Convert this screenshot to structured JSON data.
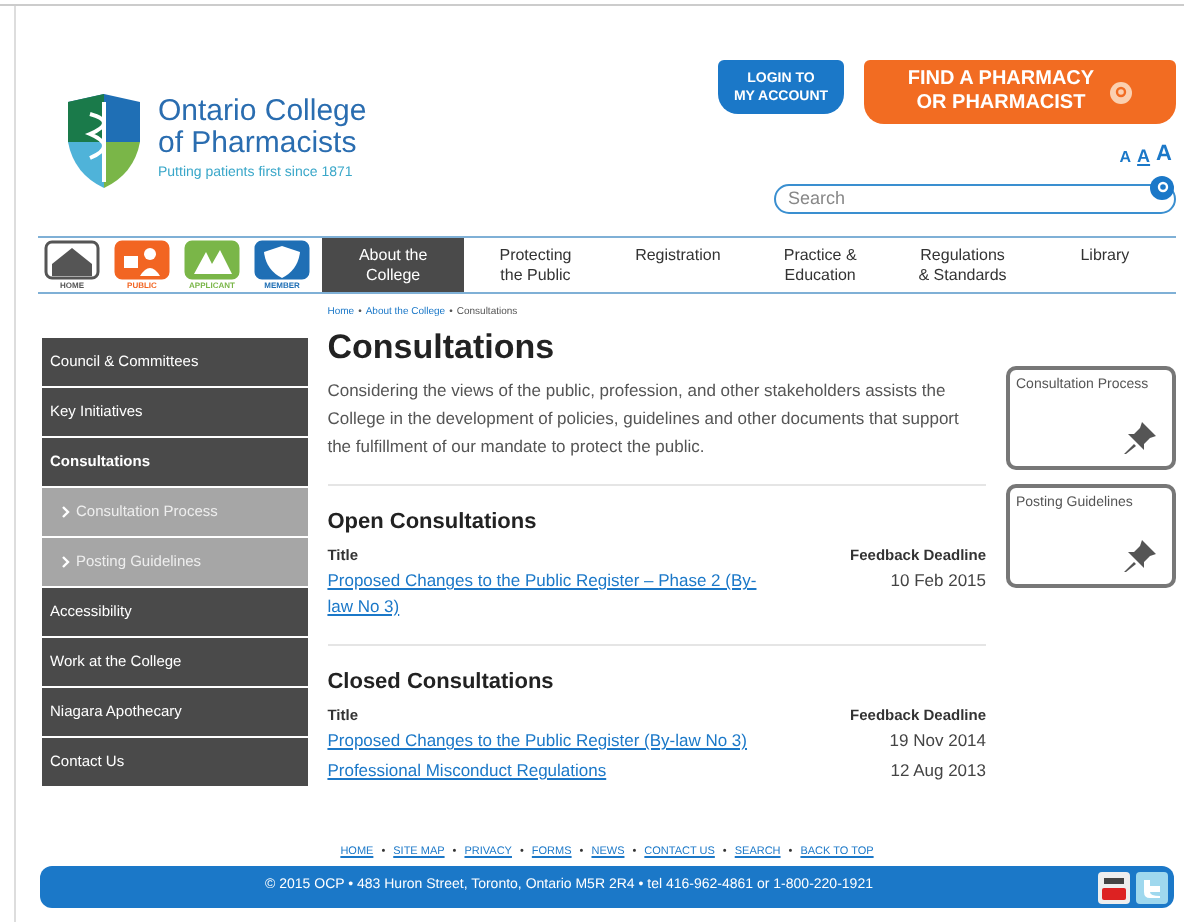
{
  "logo": {
    "name_line1": "Ontario College",
    "name_line2": "of Pharmacists",
    "tagline": "Putting patients first since 1871"
  },
  "login_button": {
    "line1": "LOGIN TO",
    "line2": "MY ACCOUNT"
  },
  "find_button": {
    "line1": "FIND A PHARMACY",
    "line2": "OR PHARMACIST"
  },
  "text_size": [
    {
      "label": "A",
      "selected": false
    },
    {
      "label": "A",
      "selected": true
    },
    {
      "label": "A",
      "selected": false
    }
  ],
  "search": {
    "placeholder": "Search"
  },
  "nav_icons": [
    {
      "label": "HOME",
      "kind": "home",
      "color": "#555555"
    },
    {
      "label": "PUBLIC",
      "kind": "public",
      "color": "#f26522"
    },
    {
      "label": "APPLICANT",
      "kind": "applicant",
      "color": "#7ab648"
    },
    {
      "label": "MEMBER",
      "kind": "member",
      "color": "#1f6fb5"
    }
  ],
  "nav_tabs": [
    {
      "line1": "About the",
      "line2": "College",
      "selected": true
    },
    {
      "line1": "Protecting",
      "line2": "the Public",
      "selected": false
    },
    {
      "line1": "Registration",
      "selected": false
    },
    {
      "line1": "Practice &",
      "line2": "Education",
      "selected": false
    },
    {
      "line1": "Regulations",
      "line2": "& Standards",
      "selected": false
    },
    {
      "line1": "Library",
      "selected": false
    }
  ],
  "breadcrumb": [
    "Home",
    "About the College",
    "Consultations"
  ],
  "sidebar": {
    "items": [
      {
        "label": "Council & Committees",
        "selected": false
      },
      {
        "label": "Key Initiatives",
        "selected": false
      },
      {
        "label": "Consultations",
        "selected": true,
        "children": [
          {
            "label": "Consultation Process",
            "selected": false
          },
          {
            "label": "Posting Guidelines",
            "selected": false
          }
        ]
      },
      {
        "label": "Accessibility",
        "selected": false
      },
      {
        "label": "Work at the College",
        "selected": false
      },
      {
        "label": "Niagara Apothecary",
        "selected": false
      },
      {
        "label": "Contact Us",
        "selected": false
      }
    ]
  },
  "page_title": "Consultations",
  "intro": "Considering the views of the public, profession, and other stakeholders assists the College in the development of policies, guidelines and other documents that support the fulfillment of our mandate to protect the public.",
  "sections": [
    {
      "heading": "Open Consultations",
      "columns": [
        "Title",
        "Feedback Deadline"
      ],
      "rows": [
        {
          "title": "Proposed Changes to the Public Register – Phase 2 (By-law No 3)",
          "deadline": "10 Feb 2015"
        }
      ]
    },
    {
      "heading": "Closed Consultations",
      "columns": [
        "Title",
        "Feedback Deadline"
      ],
      "rows": [
        {
          "title": "Proposed Changes to the Public Register (By-law No 3)",
          "deadline": "19 Nov 2014"
        },
        {
          "title": "Professional Misconduct Regulations",
          "deadline": "12 Aug 2013"
        }
      ]
    }
  ],
  "side_cards": [
    "Consultation Process",
    "Posting Guidelines"
  ],
  "footer_links": [
    "HOME",
    "SITE MAP",
    "PRIVACY",
    "FORMS",
    "NEWS",
    "CONTACT US",
    "SEARCH",
    "BACK TO TOP"
  ],
  "footer_separator": "•",
  "footer_text": "© 2015 OCP • 483 Huron Street, Toronto, Ontario M5R 2R4 • tel 416-962-4861 or 1-800-220-1921"
}
